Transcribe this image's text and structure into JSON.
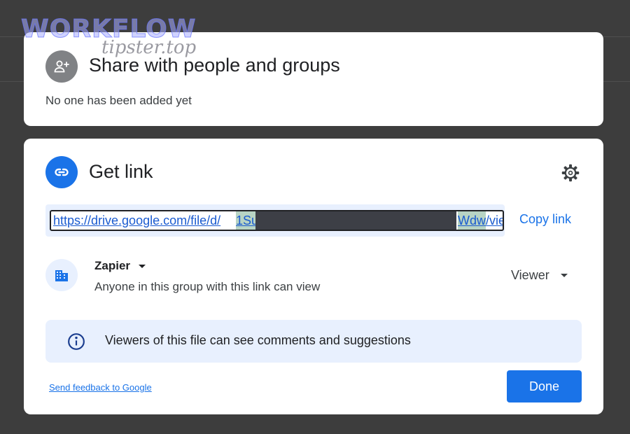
{
  "watermark": {
    "line1": "WORKFLOW",
    "line2": "tipster.top"
  },
  "share_section": {
    "title": "Share with people and groups",
    "subtitle": "No one has been added yet",
    "icon": "person-add-icon"
  },
  "link_section": {
    "title": "Get link",
    "icon": "link-icon",
    "settings_icon": "gear-icon",
    "url": {
      "prefix": "https://drive.google.com/file/d/",
      "highlight_start": "1Su",
      "highlight_end": "Wdw",
      "suffix": "/vie"
    },
    "copy_label": "Copy link",
    "access": {
      "icon": "building-icon",
      "group_name": "Zapier",
      "description": "Anyone in this group with this link can view",
      "role": "Viewer"
    },
    "info": {
      "icon": "info-icon",
      "text": "Viewers of this file can see comments and suggestions"
    },
    "feedback_label": "Send feedback to Google",
    "done_label": "Done"
  },
  "colors": {
    "accent": "#1a73e8",
    "backdrop": "#3d3d3d",
    "info_bg": "#e8f0fe",
    "url_highlight": "#b8d4c4"
  }
}
